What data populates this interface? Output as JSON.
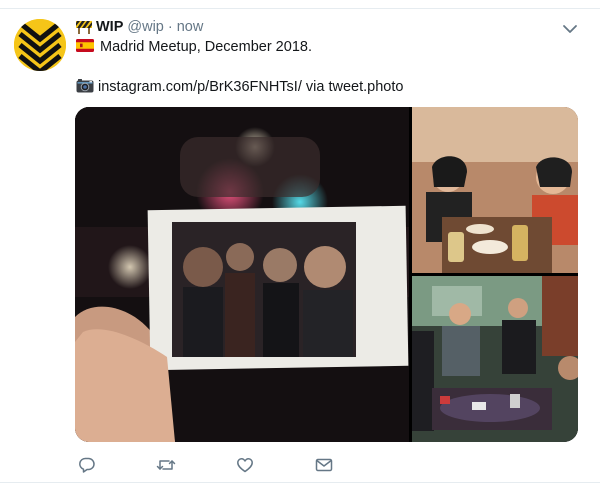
{
  "tweet": {
    "author_name": "WIP",
    "author_handle": "@wip",
    "separator": "·",
    "time": "now",
    "line1_text": "Madrid Meetup, December 2018.",
    "link_text": "instagram.com/p/BrK36FNHTsI/",
    "via_text": "via tweet.photo"
  },
  "icons": {
    "badge": "construction-sign-icon",
    "flag": "spain-flag-icon",
    "camera": "camera-icon",
    "caret": "chevron-down-icon",
    "reply": "reply-icon",
    "retweet": "retweet-icon",
    "like": "heart-icon",
    "dm": "envelope-icon"
  },
  "colors": {
    "text": "#14171a",
    "muted": "#657786",
    "avatar_yellow": "#f5c518",
    "icon_gray": "#657786"
  }
}
